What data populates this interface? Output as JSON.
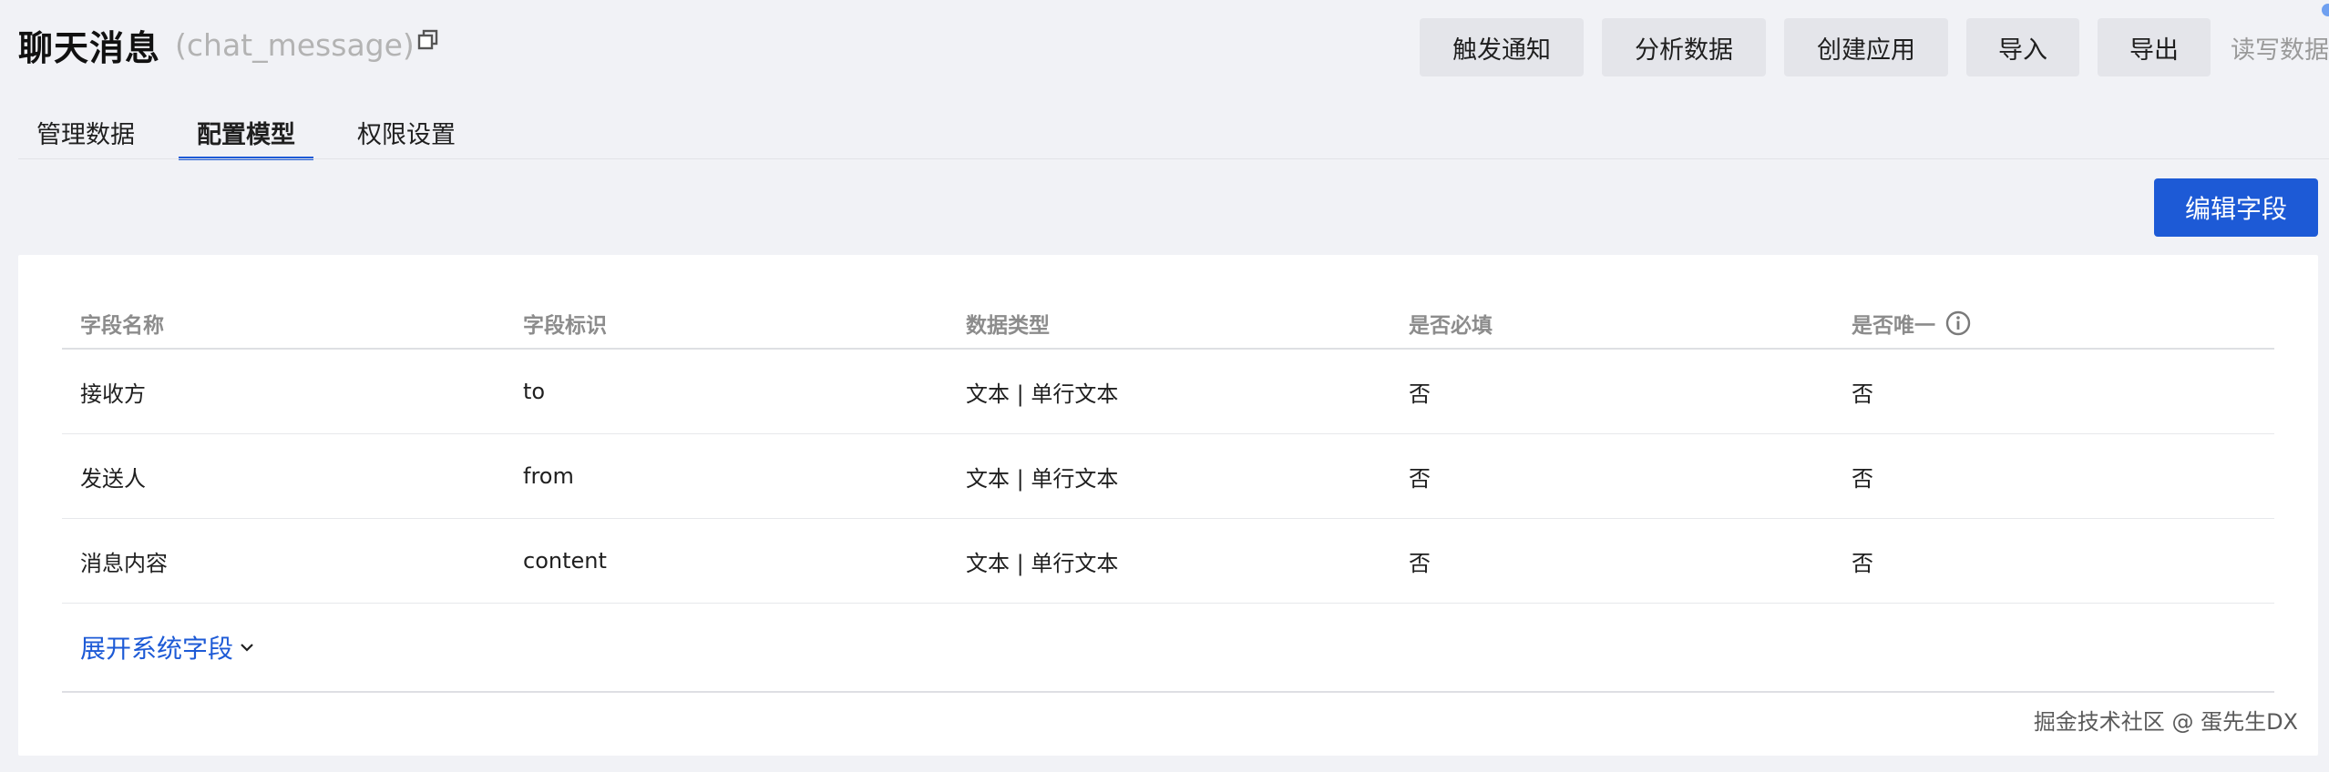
{
  "header": {
    "title": "聊天消息",
    "identifier": "(chat_message)"
  },
  "actions": {
    "trigger": "触发通知",
    "analyze": "分析数据",
    "create_app": "创建应用",
    "import": "导入",
    "export": "导出",
    "read_write": "读写数据"
  },
  "tabs": [
    {
      "label": "管理数据",
      "active": false
    },
    {
      "label": "配置模型",
      "active": true
    },
    {
      "label": "权限设置",
      "active": false
    }
  ],
  "edit_fields_label": "编辑字段",
  "table": {
    "headers": [
      "字段名称",
      "字段标识",
      "数据类型",
      "是否必填",
      "是否唯一"
    ],
    "rows": [
      [
        "接收方",
        "to",
        "文本 | 单行文本",
        "否",
        "否"
      ],
      [
        "发送人",
        "from",
        "文本 | 单行文本",
        "否",
        "否"
      ],
      [
        "消息内容",
        "content",
        "文本 | 单行文本",
        "否",
        "否"
      ]
    ]
  },
  "expand_label": "展开系统字段",
  "watermark": "掘金技术社区 @ 蛋先生DX",
  "colors": {
    "primary": "#1d5ad6",
    "background": "#f1f2f6",
    "button_gray": "#e4e5ea"
  },
  "icons": {
    "copy": "copy-icon",
    "info": "info-icon",
    "chevron": "chevron-down-icon"
  }
}
